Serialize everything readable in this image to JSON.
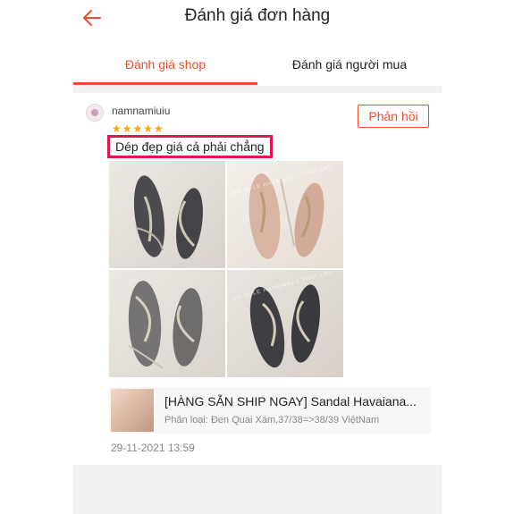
{
  "header": {
    "title": "Đánh giá đơn hàng",
    "back_icon": "arrow-left-icon"
  },
  "tabs": [
    {
      "label": "Đánh giá shop",
      "active": true
    },
    {
      "label": "Đánh giá người mua",
      "active": false
    }
  ],
  "review": {
    "username": "namnamiuiu",
    "rating_stars": "★★★★★",
    "rating": 5,
    "reply_label": "Phản hồi",
    "text": "Dép đẹp giá cả phải chẳng",
    "date": "29-11-2021 13:59",
    "photos": [
      "sandal-photo-1",
      "sandal-photo-2",
      "sandal-photo-3",
      "sandal-photo-4"
    ],
    "photo_watermark": "ĐỒ SI LE HAVAIANAS THÁI LAN"
  },
  "product": {
    "name": "[HÀNG SẴN SHIP NGAY] Sandal Havaiana...",
    "variant": "Phân loại: Đen Quai Xám,37/38=>38/39 ViệtNam"
  },
  "colors": {
    "accent": "#ee4d2d",
    "highlight_box": "#e2184f",
    "star": "#f6a700"
  }
}
